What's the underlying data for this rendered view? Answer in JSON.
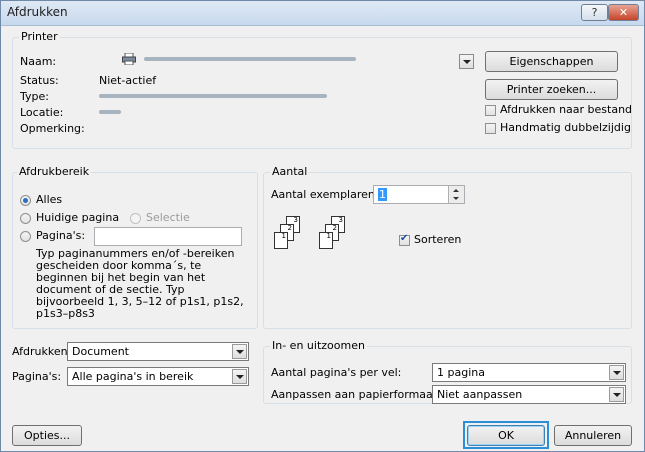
{
  "window": {
    "title": "Afdrukken",
    "help_label": "?",
    "close_label": "✕"
  },
  "printer": {
    "group_label": "Printer",
    "name_label": "Naam:",
    "status_label": "Status:",
    "status_value": "Niet-actief",
    "type_label": "Type:",
    "location_label": "Locatie:",
    "comment_label": "Opmerking:",
    "properties_button": "Eigenschappen",
    "find_printer_button": "Printer zoeken...",
    "print_to_file": "Afdrukken naar bestand",
    "manual_duplex": "Handmatig dubbelzijdig"
  },
  "range": {
    "group_label": "Afdrukbereik",
    "all": "Alles",
    "current_page": "Huidige pagina",
    "selection": "Selectie",
    "pages": "Pagina's:",
    "help_text": [
      "Typ paginanummers en/of -bereiken",
      "gescheiden door komma´s, te",
      "beginnen bij het begin van het",
      "document of de sectie. Typ",
      "bijvoorbeeld 1, 3, 5–12 of p1s1, p1s2,",
      "p1s3–p8s3"
    ]
  },
  "copies": {
    "group_label": "Aantal",
    "count_label": "Aantal exemplaren:",
    "count_value": "1",
    "collate": "Sorteren",
    "collate_checked": true,
    "page_numbers": [
      "3",
      "2",
      "1"
    ]
  },
  "bottom_left": {
    "print_what_label": "Afdrukken:",
    "print_what_value": "Document",
    "print_label": "Pagina's:",
    "print_value": "Alle pagina's in bereik"
  },
  "zoom": {
    "group_label": "In- en uitzoomen",
    "pages_per_sheet_label": "Aantal pagina's per vel:",
    "pages_per_sheet_value": "1 pagina",
    "scale_label": "Aanpassen aan papierformaat:",
    "scale_value": "Niet aanpassen"
  },
  "buttons": {
    "options": "Opties...",
    "ok": "OK",
    "cancel": "Annuleren"
  }
}
